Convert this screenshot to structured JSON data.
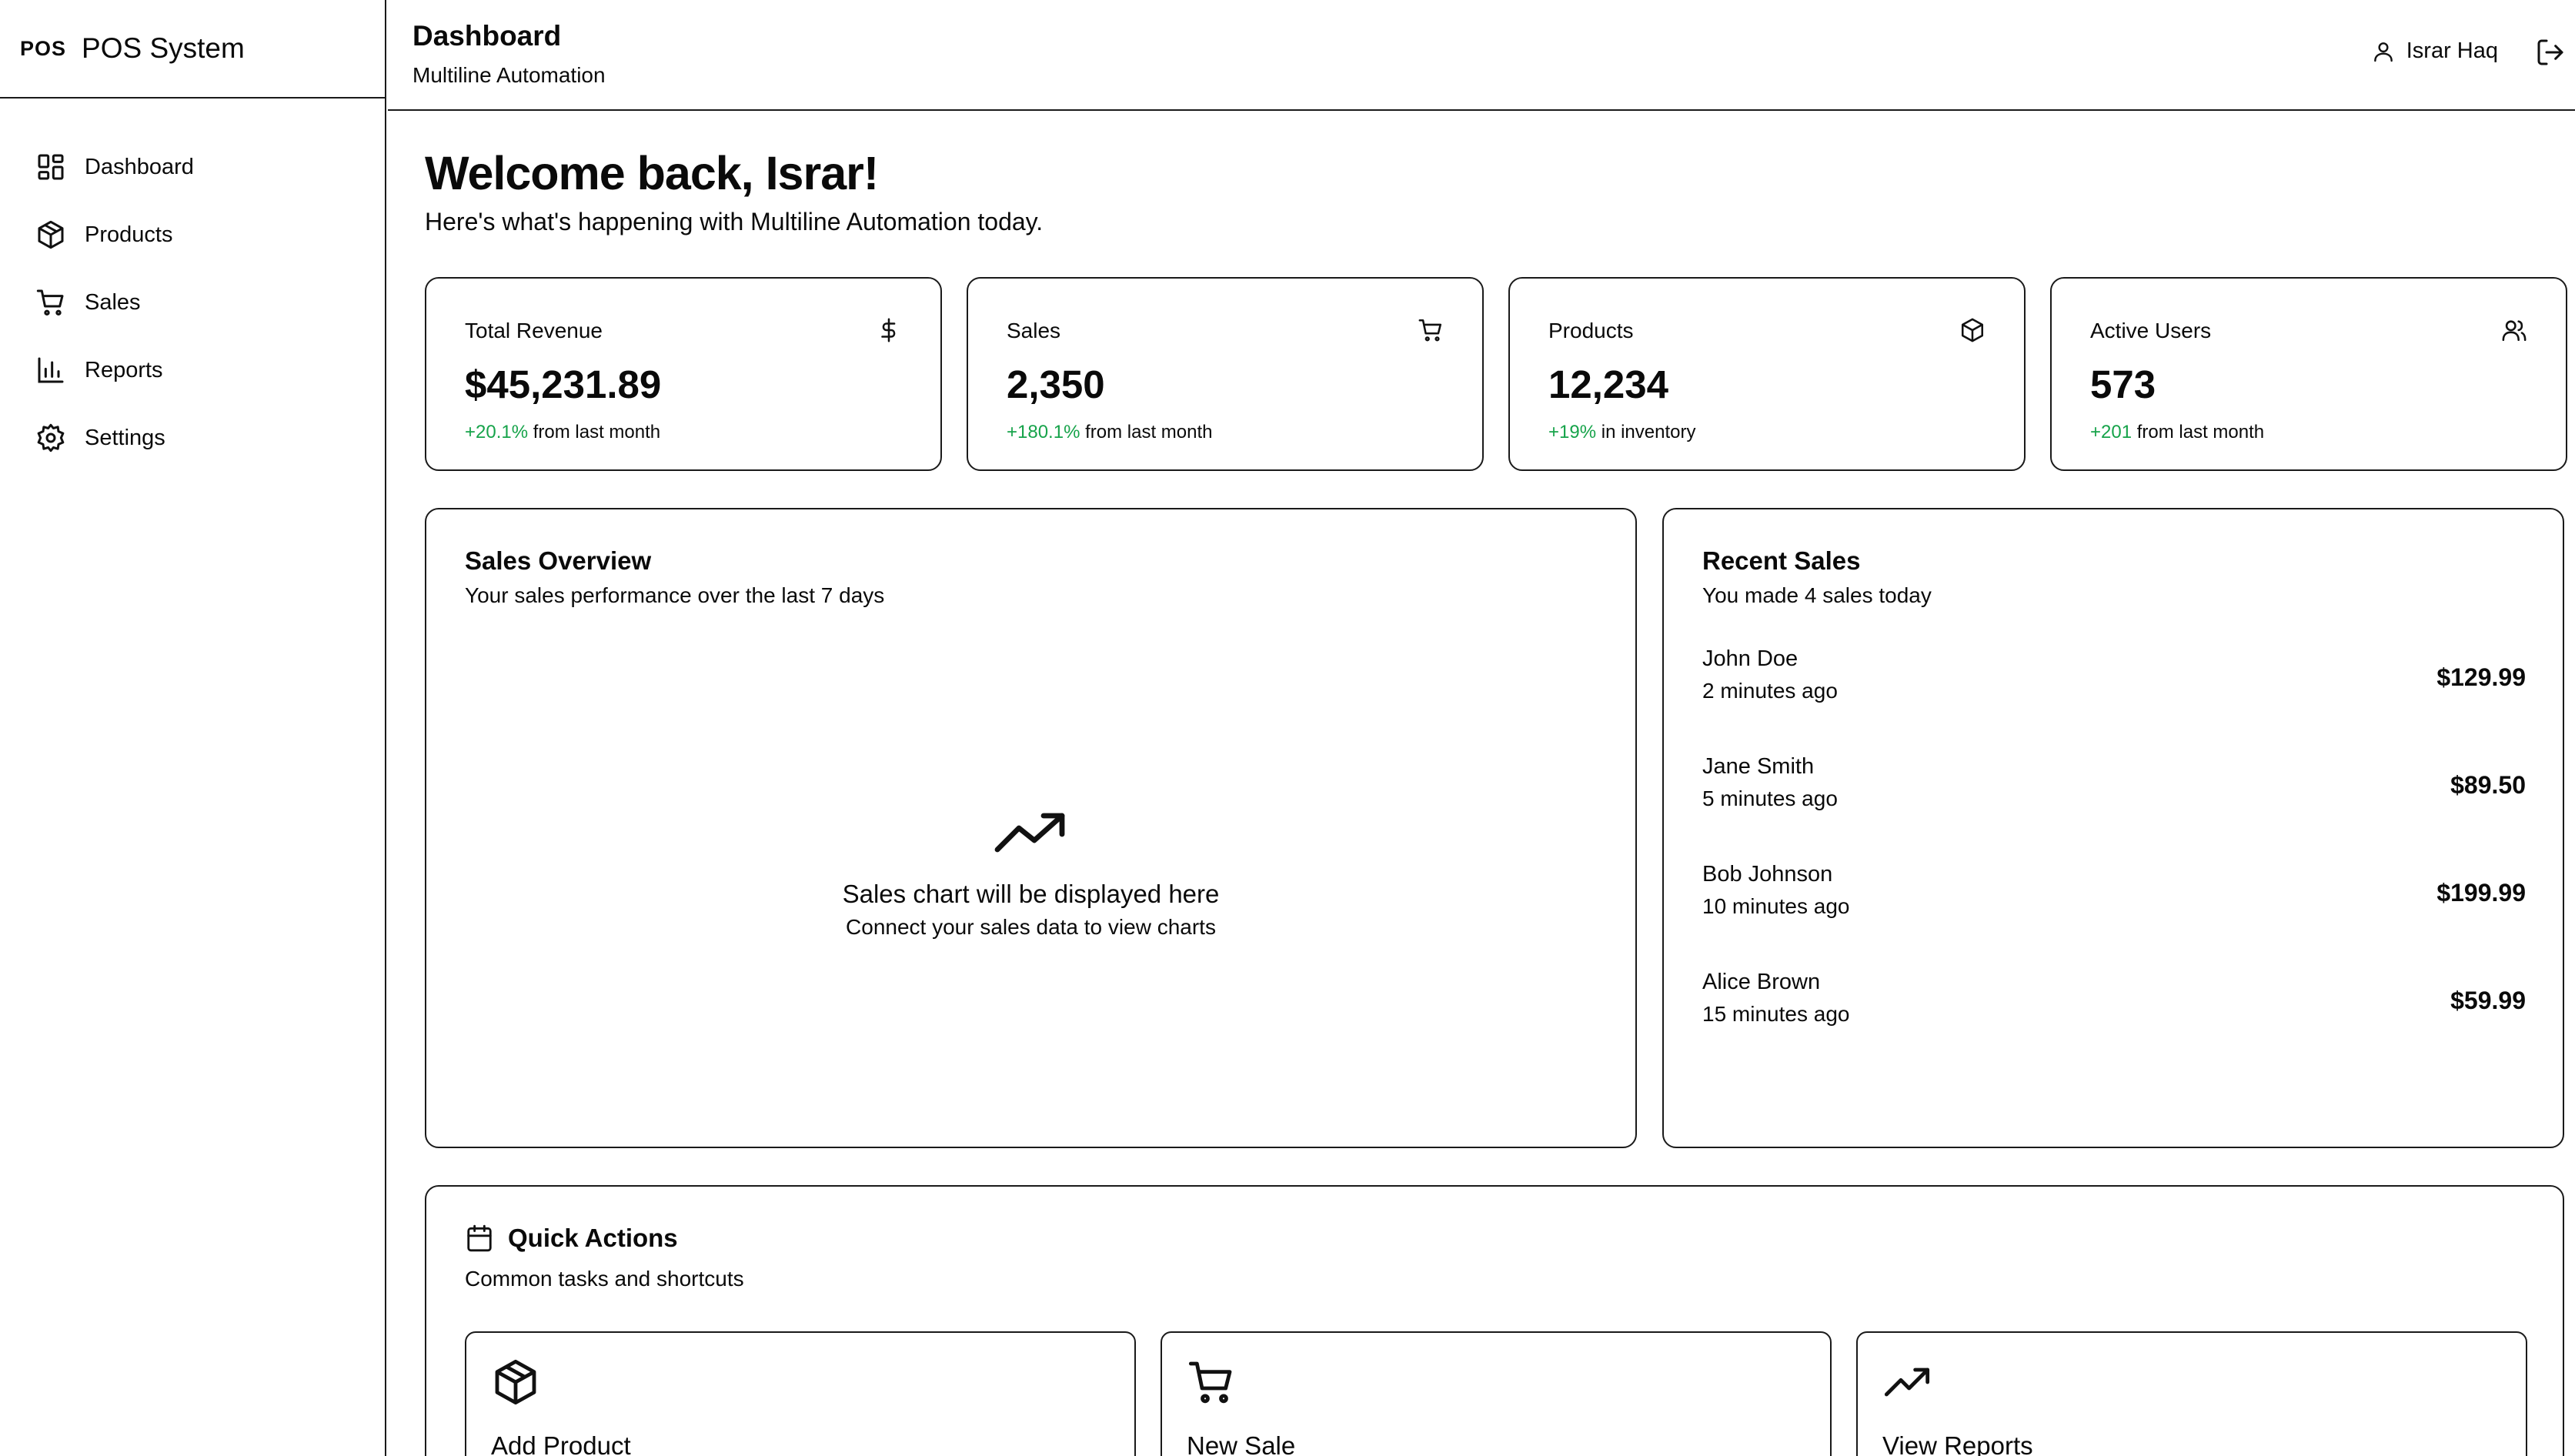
{
  "sidebar": {
    "logo": "POS",
    "app_name": "POS System",
    "items": [
      {
        "label": "Dashboard",
        "icon": "layout-dashboard-icon"
      },
      {
        "label": "Products",
        "icon": "package-icon"
      },
      {
        "label": "Sales",
        "icon": "shopping-cart-icon"
      },
      {
        "label": "Reports",
        "icon": "bar-chart-icon"
      },
      {
        "label": "Settings",
        "icon": "gear-icon"
      }
    ]
  },
  "header": {
    "title": "Dashboard",
    "subtitle": "Multiline Automation",
    "user_name": "Israr Haq"
  },
  "welcome": {
    "title": "Welcome back, Israr!",
    "subtitle": "Here's what's happening with Multiline Automation today."
  },
  "stats": [
    {
      "label": "Total Revenue",
      "value": "$45,231.89",
      "delta": "+20.1%",
      "suffix": " from last month",
      "icon": "dollar-icon"
    },
    {
      "label": "Sales",
      "value": "2,350",
      "delta": "+180.1%",
      "suffix": " from last month",
      "icon": "shopping-cart-icon"
    },
    {
      "label": "Products",
      "value": "12,234",
      "delta": "+19%",
      "suffix": " in inventory",
      "icon": "package-icon"
    },
    {
      "label": "Active Users",
      "value": "573",
      "delta": "+201",
      "suffix": " from last month",
      "icon": "users-icon"
    }
  ],
  "sales_overview": {
    "title": "Sales Overview",
    "subtitle": "Your sales performance over the last 7 days",
    "empty_title": "Sales chart will be displayed here",
    "empty_sub": "Connect your sales data to view charts"
  },
  "recent_sales": {
    "title": "Recent Sales",
    "subtitle": "You made 4 sales today",
    "items": [
      {
        "name": "John Doe",
        "time": "2 minutes ago",
        "amount": "$129.99"
      },
      {
        "name": "Jane Smith",
        "time": "5 minutes ago",
        "amount": "$89.50"
      },
      {
        "name": "Bob Johnson",
        "time": "10 minutes ago",
        "amount": "$199.99"
      },
      {
        "name": "Alice Brown",
        "time": "15 minutes ago",
        "amount": "$59.99"
      }
    ]
  },
  "quick_actions": {
    "title": "Quick Actions",
    "subtitle": "Common tasks and shortcuts",
    "items": [
      {
        "label": "Add Product",
        "icon": "package-icon"
      },
      {
        "label": "New Sale",
        "icon": "shopping-cart-icon"
      },
      {
        "label": "View Reports",
        "icon": "trending-up-icon"
      }
    ]
  },
  "colors": {
    "positive": "#16a34a",
    "border": "#1a1a1a"
  }
}
